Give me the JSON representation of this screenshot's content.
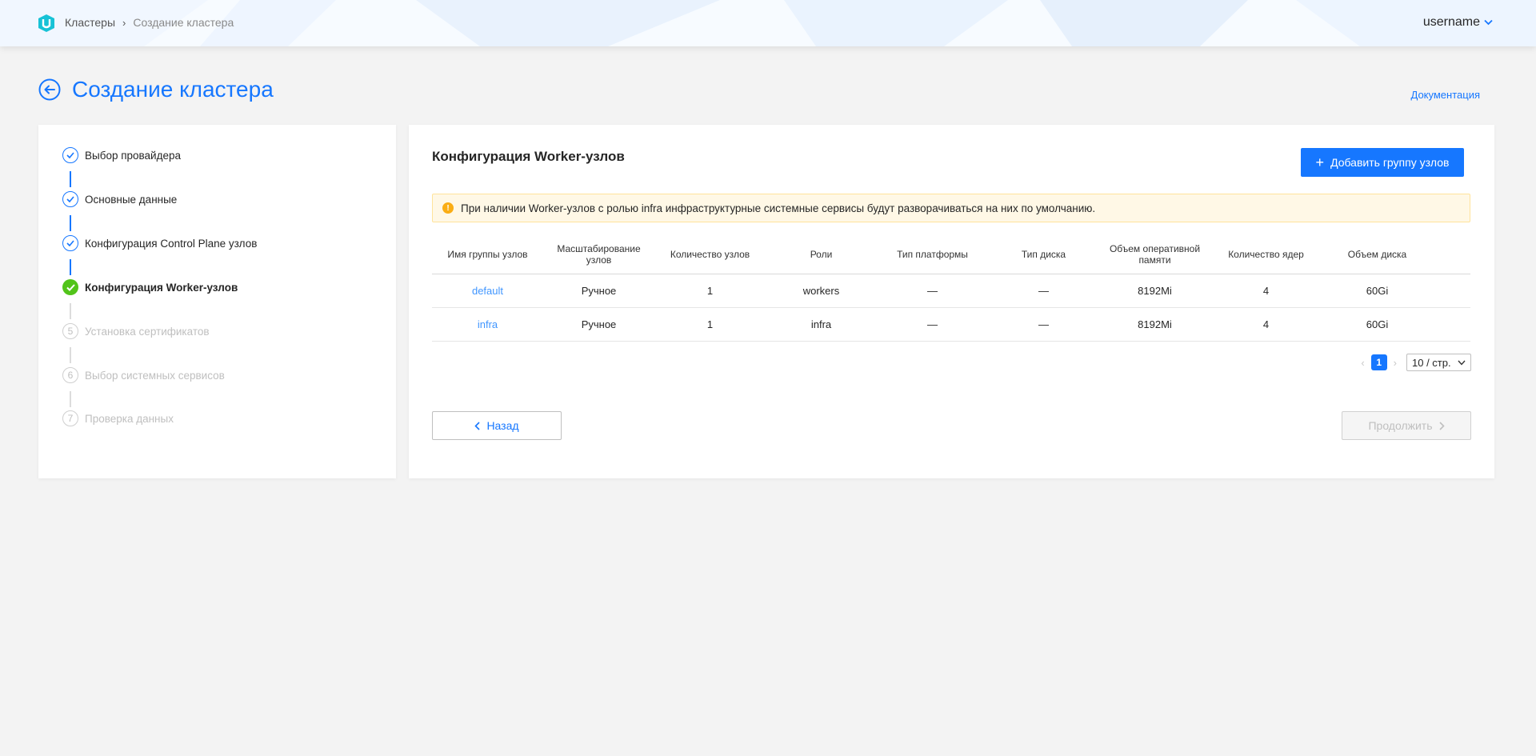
{
  "header": {
    "breadcrumb": [
      "Кластеры",
      "Создание кластера"
    ],
    "user": "username"
  },
  "page": {
    "title": "Создание кластера",
    "doc_link": "Документация"
  },
  "steps": [
    {
      "label": "Выбор провайдера",
      "state": "done"
    },
    {
      "label": "Основные данные",
      "state": "done"
    },
    {
      "label": "Конфигурация Control Plane узлов",
      "state": "done"
    },
    {
      "label": "Конфигурация Worker-узлов",
      "state": "active"
    },
    {
      "number": "5",
      "label": "Установка сертификатов",
      "state": "todo"
    },
    {
      "number": "6",
      "label": "Выбор системных сервисов",
      "state": "todo"
    },
    {
      "number": "7",
      "label": "Проверка данных",
      "state": "todo"
    }
  ],
  "main": {
    "title": "Конфигурация Worker-узлов",
    "add_button": "Добавить группу узлов",
    "alert": "При наличии Worker-узлов с ролью infra инфраструктурные системные сервисы будут разворачиваться на них по умолчанию.",
    "table": {
      "columns": [
        "Имя группы узлов",
        "Масштабирование узлов",
        "Количество узлов",
        "Роли",
        "Тип платформы",
        "Тип диска",
        "Объем оперативной памяти",
        "Количество ядер",
        "Объем диска"
      ],
      "rows": [
        [
          "default",
          "Ручное",
          "1",
          "workers",
          "—",
          "—",
          "8192Mi",
          "4",
          "60Gi"
        ],
        [
          "infra",
          "Ручное",
          "1",
          "infra",
          "—",
          "—",
          "8192Mi",
          "4",
          "60Gi"
        ]
      ]
    },
    "pagination": {
      "current_page": "1",
      "page_size": "10 / стр."
    },
    "back_button": "Назад",
    "next_button": "Продолжить"
  },
  "colors": {
    "accent": "#1677ff",
    "success": "#52c41a",
    "warning": "#faad14"
  }
}
